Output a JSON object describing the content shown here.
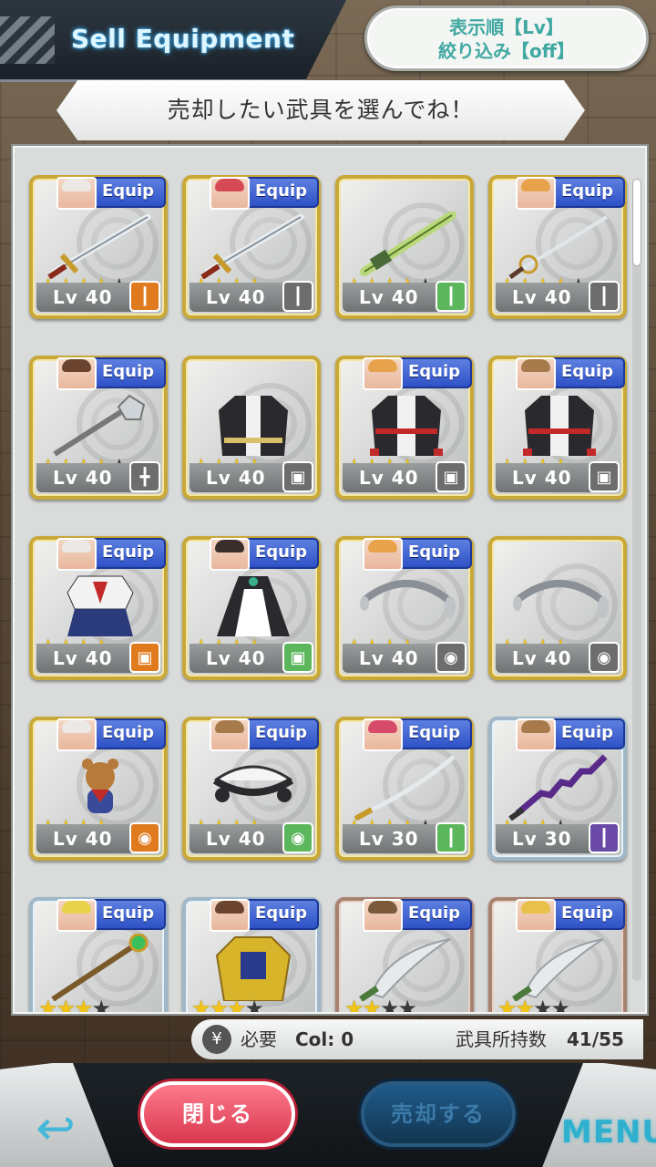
{
  "header": {
    "title": "Sell Equipment",
    "sort_label": "表示順【Lv】",
    "filter_label": "絞り込み【off】"
  },
  "instruction": "売却したい武具を選んでね！",
  "equip_label": "Equip",
  "items": [
    {
      "equipped": true,
      "hair": "#ebe8e6",
      "frame": "gold",
      "stars": 4,
      "max": 5,
      "lv": "Lv 40",
      "type_color": "#e07a1f",
      "type_icon": "sword-icon",
      "type_glyph": "┃",
      "item": "long-sword"
    },
    {
      "equipped": true,
      "hair": "#d64a56",
      "frame": "gold",
      "stars": 4,
      "max": 4,
      "lv": "Lv 40",
      "type_color": "#6d6d6d",
      "type_icon": "sword-icon",
      "type_glyph": "┃",
      "item": "long-sword"
    },
    {
      "equipped": false,
      "hair": "",
      "frame": "gold",
      "stars": 4,
      "max": 5,
      "lv": "Lv 40",
      "type_color": "#5cb65c",
      "type_icon": "sword-icon",
      "type_glyph": "┃",
      "item": "green-sword"
    },
    {
      "equipped": true,
      "hair": "#e7a24b",
      "frame": "gold",
      "stars": 4,
      "max": 5,
      "lv": "Lv 40",
      "type_color": "#6d6d6d",
      "type_icon": "rapier-icon",
      "type_glyph": "┃",
      "item": "rapier"
    },
    {
      "equipped": true,
      "hair": "#6b4430",
      "frame": "gold",
      "stars": 4,
      "max": 5,
      "lv": "Lv 40",
      "type_color": "#6d6d6d",
      "type_icon": "mace-icon",
      "type_glyph": "╋",
      "item": "mace"
    },
    {
      "equipped": false,
      "hair": "",
      "frame": "gold",
      "stars": 4,
      "max": 4,
      "lv": "Lv 40",
      "type_color": "#6d6d6d",
      "type_icon": "armor-icon",
      "type_glyph": "▣",
      "item": "black-coat"
    },
    {
      "equipped": true,
      "hair": "#e7a24b",
      "frame": "gold",
      "stars": 4,
      "max": 4,
      "lv": "Lv 40",
      "type_color": "#6d6d6d",
      "type_icon": "armor-icon",
      "type_glyph": "▣",
      "item": "red-coat"
    },
    {
      "equipped": true,
      "hair": "#a67a4a",
      "frame": "gold",
      "stars": 4,
      "max": 4,
      "lv": "Lv 40",
      "type_color": "#6d6d6d",
      "type_icon": "armor-icon",
      "type_glyph": "▣",
      "item": "red-coat"
    },
    {
      "equipped": true,
      "hair": "#ebe8e6",
      "frame": "gold",
      "stars": 4,
      "max": 4,
      "lv": "Lv 40",
      "type_color": "#e07a1f",
      "type_icon": "armor-icon",
      "type_glyph": "▣",
      "item": "sailor-uniform"
    },
    {
      "equipped": true,
      "hair": "#3a2e2a",
      "frame": "gold",
      "stars": 4,
      "max": 4,
      "lv": "Lv 40",
      "type_color": "#5cb65c",
      "type_icon": "armor-icon",
      "type_glyph": "▣",
      "item": "maid-dress"
    },
    {
      "equipped": true,
      "hair": "#e7a24b",
      "frame": "gold",
      "stars": 4,
      "max": 4,
      "lv": "Lv 40",
      "type_color": "#6d6d6d",
      "type_icon": "accessory-icon",
      "type_glyph": "◉",
      "item": "headband"
    },
    {
      "equipped": false,
      "hair": "",
      "frame": "gold",
      "stars": 4,
      "max": 4,
      "lv": "Lv 40",
      "type_color": "#6d6d6d",
      "type_icon": "accessory-icon",
      "type_glyph": "◉",
      "item": "headband"
    },
    {
      "equipped": true,
      "hair": "#ebe8e6",
      "frame": "gold",
      "stars": 4,
      "max": 4,
      "lv": "Lv 40",
      "type_color": "#e07a1f",
      "type_icon": "accessory-icon",
      "type_glyph": "◉",
      "item": "bear-charm"
    },
    {
      "equipped": true,
      "hair": "#a67a4a",
      "frame": "gold",
      "stars": 4,
      "max": 4,
      "lv": "Lv 40",
      "type_color": "#5cb65c",
      "type_icon": "accessory-icon",
      "type_glyph": "◉",
      "item": "maid-headdress"
    },
    {
      "equipped": true,
      "hair": "#d64a6a",
      "frame": "gold",
      "stars": 4,
      "max": 5,
      "lv": "Lv 30",
      "type_color": "#5cb65c",
      "type_icon": "sword-icon",
      "type_glyph": "┃",
      "item": "katana"
    },
    {
      "equipped": true,
      "hair": "#a67a4a",
      "frame": "silver",
      "stars": 3,
      "max": 4,
      "lv": "Lv 30",
      "type_color": "#6a4aa6",
      "type_icon": "sword-icon",
      "type_glyph": "┃",
      "item": "dark-blade"
    },
    {
      "equipped": true,
      "hair": "#e8d24a",
      "frame": "silver",
      "stars": 3,
      "max": 4,
      "lv": "",
      "type_color": "",
      "type_icon": "",
      "type_glyph": "",
      "item": "staff"
    },
    {
      "equipped": true,
      "hair": "#6b4430",
      "frame": "silver",
      "stars": 3,
      "max": 4,
      "lv": "",
      "type_color": "",
      "type_icon": "",
      "type_glyph": "",
      "item": "gold-armor"
    },
    {
      "equipped": true,
      "hair": "#7a5a3a",
      "frame": "bronze",
      "stars": 2,
      "max": 4,
      "lv": "",
      "type_color": "",
      "type_icon": "",
      "type_glyph": "",
      "item": "scimitar"
    },
    {
      "equipped": true,
      "hair": "#e8c04a",
      "frame": "bronze",
      "stars": 2,
      "max": 4,
      "lv": "",
      "type_color": "",
      "type_icon": "",
      "type_glyph": "",
      "item": "scimitar"
    }
  ],
  "footer": {
    "need_label": "必要",
    "col_label": "Col: 0",
    "own_label": "武具所持数",
    "own_count": "41/55"
  },
  "buttons": {
    "close": "閉じる",
    "sell": "売却する",
    "menu": "MENU",
    "back": "↩"
  }
}
